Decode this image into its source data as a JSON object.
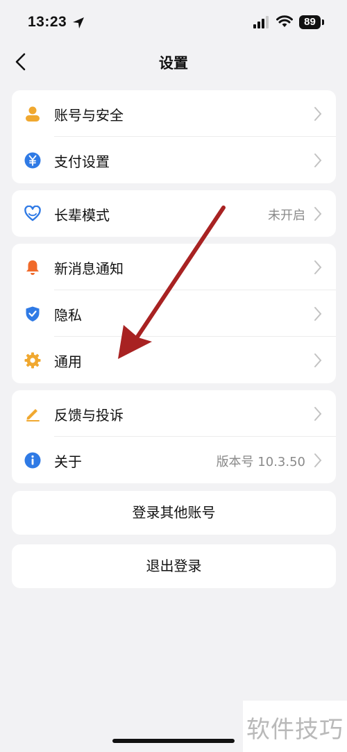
{
  "status_bar": {
    "time": "13:23",
    "battery": "89"
  },
  "header": {
    "title": "设置"
  },
  "sections": [
    {
      "items": [
        {
          "label": "账号与安全",
          "icon": "user-icon",
          "color": "#f0a830"
        },
        {
          "label": "支付设置",
          "icon": "yen-icon",
          "color": "#2f7ae5"
        }
      ]
    },
    {
      "items": [
        {
          "label": "长辈模式",
          "icon": "heart-icon",
          "color": "#2f7ae5",
          "value": "未开启"
        }
      ]
    },
    {
      "items": [
        {
          "label": "新消息通知",
          "icon": "bell-icon",
          "color": "#f06a2a"
        },
        {
          "label": "隐私",
          "icon": "shield-icon",
          "color": "#2f7ae5"
        },
        {
          "label": "通用",
          "icon": "gear-icon",
          "color": "#f0a830"
        }
      ]
    },
    {
      "items": [
        {
          "label": "反馈与投诉",
          "icon": "pencil-icon",
          "color": "#f0a830"
        },
        {
          "label": "关于",
          "icon": "info-icon",
          "color": "#2f7ae5",
          "value": "版本号 10.3.50"
        }
      ]
    }
  ],
  "buttons": {
    "switch_account": "登录其他账号",
    "logout": "退出登录"
  },
  "watermark": "软件技巧",
  "colors": {
    "annotation_arrow": "#a82222",
    "background": "#f2f2f4"
  }
}
